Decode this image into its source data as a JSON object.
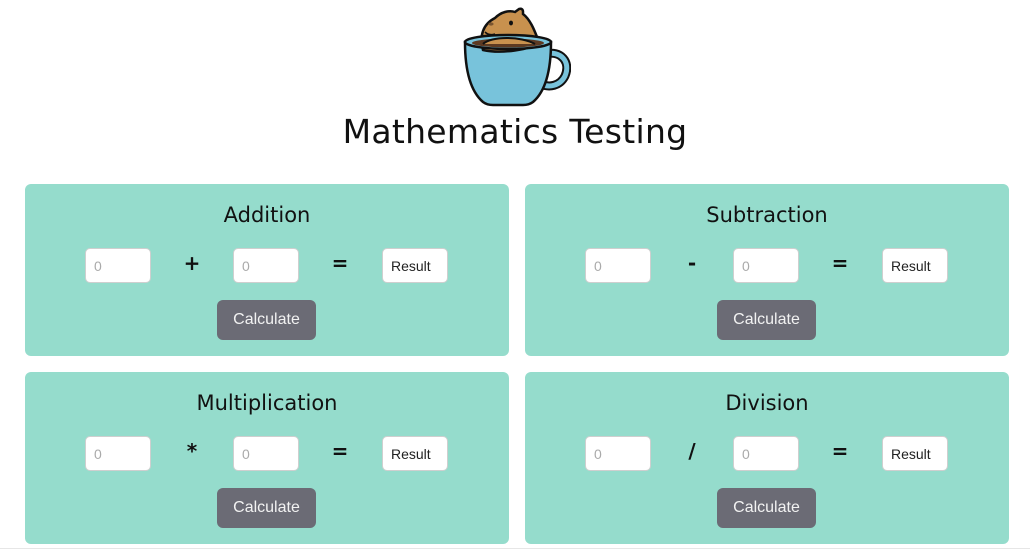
{
  "page": {
    "title": "Mathematics Testing"
  },
  "logo": {
    "icon": "capybara-in-cup-icon",
    "cup_color": "#78c3db",
    "animal_color": "#c8914e"
  },
  "colors": {
    "card_bg": "#95dccc",
    "button_bg": "#6b6b75",
    "button_text": "#f2f2f2"
  },
  "cards": [
    {
      "title": "Addition",
      "operator": "+",
      "equals": "=",
      "input1_placeholder": "0",
      "input2_placeholder": "0",
      "result_placeholder": "Result",
      "button_label": "Calculate"
    },
    {
      "title": "Subtraction",
      "operator": "-",
      "equals": "=",
      "input1_placeholder": "0",
      "input2_placeholder": "0",
      "result_placeholder": "Result",
      "button_label": "Calculate"
    },
    {
      "title": "Multiplication",
      "operator": "*",
      "equals": "=",
      "input1_placeholder": "0",
      "input2_placeholder": "0",
      "result_placeholder": "Result",
      "button_label": "Calculate"
    },
    {
      "title": "Division",
      "operator": "/",
      "equals": "=",
      "input1_placeholder": "0",
      "input2_placeholder": "0",
      "result_placeholder": "Result",
      "button_label": "Calculate"
    }
  ]
}
